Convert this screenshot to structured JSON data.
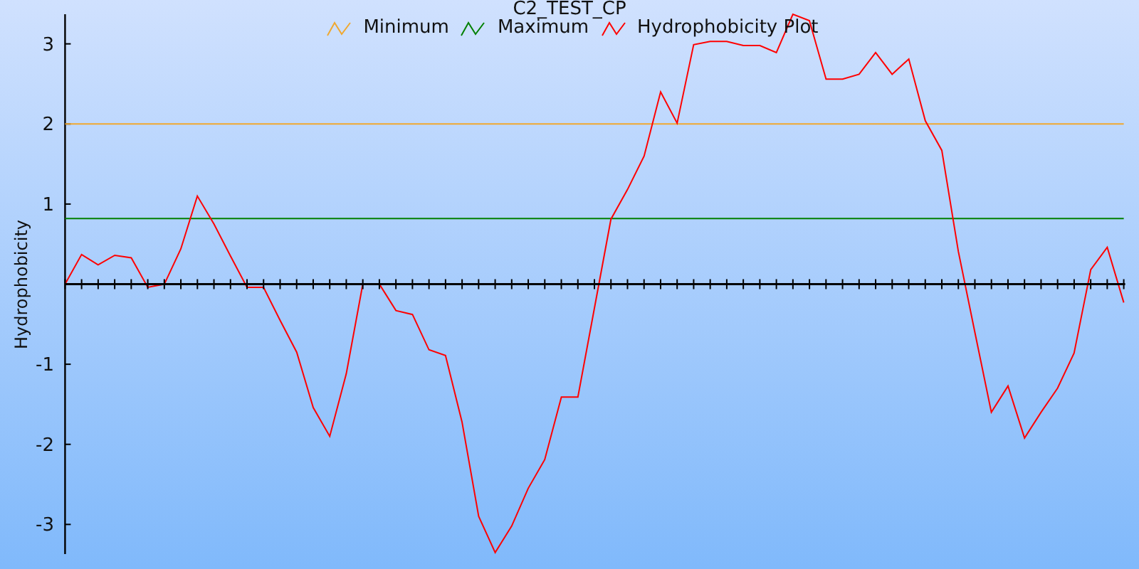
{
  "chart": {
    "chart_data": {
      "type": "line",
      "title": "C2_TEST_CP",
      "ylabel": "Hydrophobicity",
      "categories": [
        null,
        null,
        null,
        null,
        null,
        null,
        null,
        null,
        null,
        null,
        null,
        null,
        null,
        null,
        null,
        null,
        null,
        null,
        null,
        null,
        null,
        null,
        null,
        null,
        null,
        null,
        null,
        null,
        null,
        null,
        null,
        null,
        null,
        null,
        null,
        null,
        null,
        null,
        null,
        null,
        null,
        null,
        null,
        null,
        null,
        null,
        null,
        null,
        null,
        null,
        null,
        null,
        null,
        null,
        null,
        null,
        null,
        null,
        null,
        null,
        null,
        null,
        null,
        null,
        null
      ],
      "series": [
        {
          "name": "Minimum",
          "color": "#f0a830",
          "values": [
            2,
            2,
            2,
            2,
            2,
            2,
            2,
            2,
            2,
            2,
            2,
            2,
            2,
            2,
            2,
            2,
            2,
            2,
            2,
            2,
            2,
            2,
            2,
            2,
            2,
            2,
            2,
            2,
            2,
            2,
            2,
            2,
            2,
            2,
            2,
            2,
            2,
            2,
            2,
            2,
            2,
            2,
            2,
            2,
            2,
            2,
            2,
            2,
            2,
            2,
            2,
            2,
            2,
            2,
            2,
            2,
            2,
            2,
            2,
            2,
            2,
            2,
            2,
            2,
            2
          ]
        },
        {
          "name": "Maximum",
          "color": "#008000",
          "values": [
            0.82,
            0.82,
            0.82,
            0.82,
            0.82,
            0.82,
            0.82,
            0.82,
            0.82,
            0.82,
            0.82,
            0.82,
            0.82,
            0.82,
            0.82,
            0.82,
            0.82,
            0.82,
            0.82,
            0.82,
            0.82,
            0.82,
            0.82,
            0.82,
            0.82,
            0.82,
            0.82,
            0.82,
            0.82,
            0.82,
            0.82,
            0.82,
            0.82,
            0.82,
            0.82,
            0.82,
            0.82,
            0.82,
            0.82,
            0.82,
            0.82,
            0.82,
            0.82,
            0.82,
            0.82,
            0.82,
            0.82,
            0.82,
            0.82,
            0.82,
            0.82,
            0.82,
            0.82,
            0.82,
            0.82,
            0.82,
            0.82,
            0.82,
            0.82,
            0.82,
            0.82,
            0.82,
            0.82,
            0.82,
            0.82
          ]
        },
        {
          "name": "Hydrophobicity Plot",
          "color": "#ff0000",
          "values": [
            0,
            0.37,
            0.24,
            0.36,
            0.33,
            -0.04,
            0,
            0.44,
            1.1,
            0.75,
            0.35,
            -0.04,
            -0.04,
            -0.45,
            -0.85,
            -1.54,
            -1.9,
            -1.12,
            0,
            0,
            -0.33,
            -0.38,
            -0.82,
            -0.89,
            -1.72,
            -2.9,
            -3.35,
            -3.02,
            -2.55,
            -2.19,
            -1.41,
            -1.41,
            -0.3,
            0.81,
            1.18,
            1.6,
            2.4,
            2.01,
            2.99,
            3.03,
            3.03,
            2.98,
            2.98,
            2.89,
            3.37,
            3.29,
            2.56,
            2.56,
            2.62,
            2.89,
            2.62,
            2.81,
            2.04,
            1.67,
            0.41,
            -0.6,
            -1.6,
            -1.27,
            -1.92,
            -1.6,
            -1.3,
            -0.86,
            0.18,
            0.46,
            -0.23
          ]
        }
      ],
      "ylim": [
        -3.37,
        3.37
      ],
      "yticks": [
        {
          "value": -3,
          "label": "-3"
        },
        {
          "value": -2,
          "label": "-2"
        },
        {
          "value": -1,
          "label": "-1"
        },
        {
          "value": 1,
          "label": "1"
        },
        {
          "value": 2,
          "label": "2"
        },
        {
          "value": 3,
          "label": "3"
        }
      ]
    }
  }
}
